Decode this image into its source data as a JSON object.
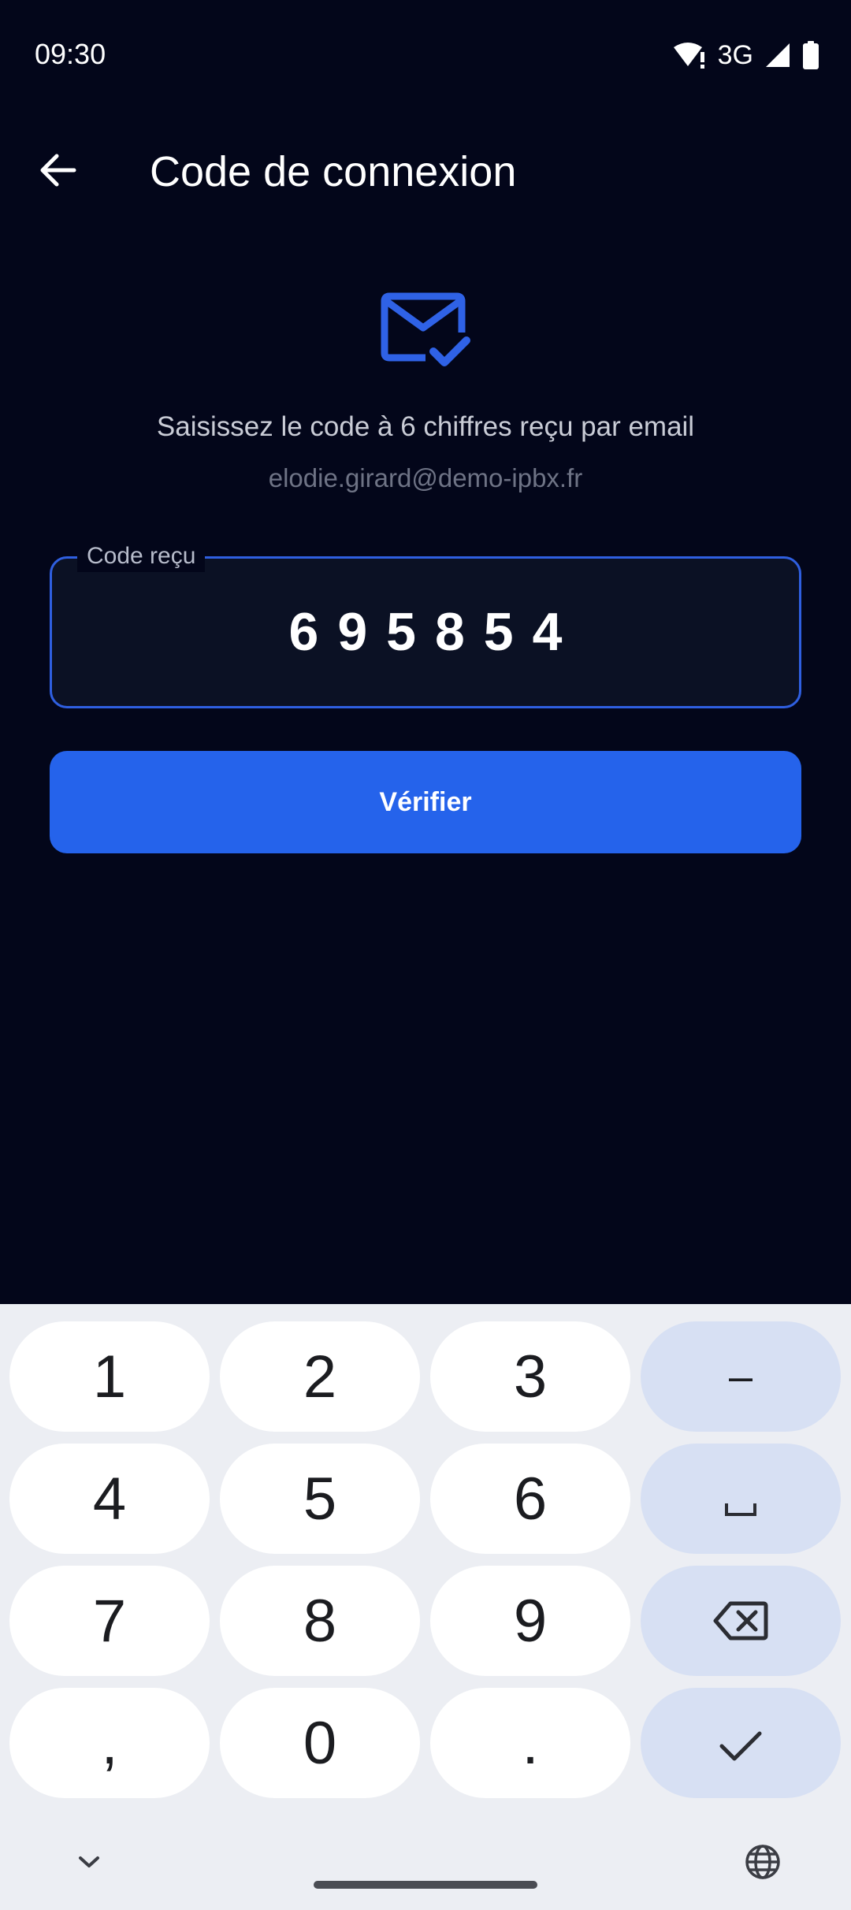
{
  "status_bar": {
    "time": "09:30",
    "network": "3G"
  },
  "app_bar": {
    "title": "Code de connexion"
  },
  "content": {
    "prompt": "Saisissez le code à 6 chiffres reçu par email",
    "email": "elodie.girard@demo-ipbx.fr",
    "code_label": "Code reçu",
    "code_value": "695854",
    "verify_label": "Vérifier"
  },
  "keyboard": {
    "keys": [
      "1",
      "2",
      "3",
      "–",
      "4",
      "5",
      "6",
      "␣",
      "7",
      "8",
      "9",
      "backspace",
      ",",
      "0",
      ".",
      "done"
    ]
  },
  "colors": {
    "background": "#03061a",
    "accent": "#2563eb",
    "keyboard_bg": "#eceef3",
    "function_key": "#d7e0f3"
  }
}
